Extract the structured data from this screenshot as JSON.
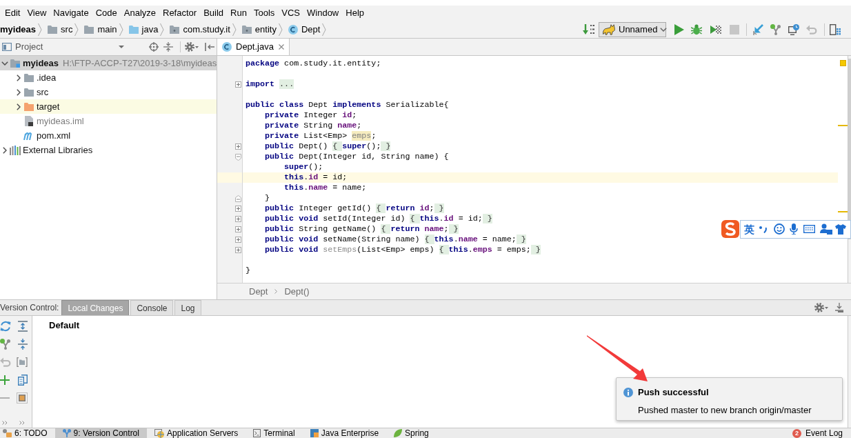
{
  "menu_bar": {
    "items": [
      "Edit",
      "View",
      "Navigate",
      "Code",
      "Analyze",
      "Refactor",
      "Build",
      "Run",
      "Tools",
      "VCS",
      "Window",
      "Help"
    ]
  },
  "navigation_bar": {
    "breadcrumbs": [
      {
        "label": "myideas",
        "kind": "project"
      },
      {
        "label": "src",
        "kind": "folder"
      },
      {
        "label": "main",
        "kind": "folder"
      },
      {
        "label": "java",
        "kind": "source_folder"
      },
      {
        "label": "com.study.it",
        "kind": "package"
      },
      {
        "label": "entity",
        "kind": "package"
      },
      {
        "label": "Dept",
        "kind": "class"
      }
    ],
    "run_configuration": "Unnamed"
  },
  "project_panel": {
    "title": "Project",
    "tree": [
      {
        "label": "myideas",
        "detail": "H:\\FTP-ACCP-T27\\2019-3-18\\myideas",
        "kind": "module",
        "expanded": true,
        "selected": true,
        "highlighted": false,
        "dimmed": false,
        "children": [
          {
            "label": ".idea",
            "kind": "folder",
            "expanded": false,
            "selected": false,
            "highlighted": false,
            "dimmed": false
          },
          {
            "label": "src",
            "kind": "folder",
            "expanded": false,
            "selected": false,
            "highlighted": false,
            "dimmed": false
          },
          {
            "label": "target",
            "kind": "excluded_folder",
            "expanded": false,
            "selected": false,
            "highlighted": true,
            "dimmed": false
          },
          {
            "label": "myideas.iml",
            "kind": "iml_file",
            "selected": false,
            "highlighted": false,
            "dimmed": true
          },
          {
            "label": "pom.xml",
            "kind": "pom_file",
            "selected": false,
            "highlighted": false,
            "dimmed": false
          }
        ]
      },
      {
        "label": "External Libraries",
        "kind": "libraries",
        "expanded": false,
        "selected": false,
        "highlighted": false,
        "dimmed": false
      }
    ]
  },
  "editor": {
    "tabs": [
      {
        "label": "Dept.java",
        "selected": true
      }
    ],
    "lines": [
      {
        "kind": "plain",
        "current": false,
        "tokens": [
          {
            "text": "package",
            "kind": "keyword"
          },
          {
            "text": " com.study.it.entity;",
            "kind": "plain"
          }
        ]
      },
      {
        "kind": "plain",
        "current": false
      },
      {
        "kind": "collapsed_fold",
        "current": false,
        "tokens": [
          {
            "text": "import ",
            "kind": "keyword"
          },
          {
            "text": "...",
            "kind": "folded"
          }
        ]
      },
      {
        "kind": "plain",
        "current": false
      },
      {
        "kind": "plain",
        "current": false,
        "tokens": [
          {
            "text": "public class",
            "kind": "keyword"
          },
          {
            "text": " Dept ",
            "kind": "plain"
          },
          {
            "text": "implements",
            "kind": "keyword"
          },
          {
            "text": " Serializable{",
            "kind": "plain"
          }
        ]
      },
      {
        "kind": "plain",
        "current": false,
        "tokens": [
          {
            "text": "    private",
            "kind": "keyword"
          },
          {
            "text": " Integer ",
            "kind": "plain"
          },
          {
            "text": "id",
            "kind": "field"
          },
          {
            "text": ";",
            "kind": "plain"
          }
        ]
      },
      {
        "kind": "plain",
        "current": false,
        "tokens": [
          {
            "text": "    private",
            "kind": "keyword"
          },
          {
            "text": " String ",
            "kind": "plain"
          },
          {
            "text": "name",
            "kind": "field"
          },
          {
            "text": ";",
            "kind": "plain"
          }
        ]
      },
      {
        "kind": "plain",
        "current": false,
        "tokens": [
          {
            "text": "    private",
            "kind": "keyword"
          },
          {
            "text": " List<Emp> ",
            "kind": "plain"
          },
          {
            "text": "emps",
            "kind": "unused_field"
          },
          {
            "text": ";",
            "kind": "plain"
          }
        ]
      },
      {
        "kind": "collapsed_fold",
        "current": false,
        "tokens": [
          {
            "text": "    public",
            "kind": "keyword"
          },
          {
            "text": " Dept() ",
            "kind": "plain"
          },
          {
            "text": "{ ",
            "kind": "folded"
          },
          {
            "text": "super",
            "kind": "keyword"
          },
          {
            "text": "();",
            "kind": "plain"
          },
          {
            "text": " }",
            "kind": "folded"
          }
        ]
      },
      {
        "kind": "fold_start",
        "current": false,
        "tokens": [
          {
            "text": "    public",
            "kind": "keyword"
          },
          {
            "text": " Dept(Integer id, String name) {",
            "kind": "plain"
          }
        ]
      },
      {
        "kind": "plain",
        "current": false,
        "tokens": [
          {
            "text": "        super",
            "kind": "keyword"
          },
          {
            "text": "();",
            "kind": "plain"
          }
        ]
      },
      {
        "kind": "plain",
        "current": true,
        "tokens": [
          {
            "text": "        this",
            "kind": "keyword"
          },
          {
            "text": ".",
            "kind": "plain"
          },
          {
            "text": "id",
            "kind": "field"
          },
          {
            "text": " = id;",
            "kind": "plain"
          }
        ]
      },
      {
        "kind": "plain",
        "current": false,
        "tokens": [
          {
            "text": "        this",
            "kind": "keyword"
          },
          {
            "text": ".",
            "kind": "plain"
          },
          {
            "text": "name",
            "kind": "field"
          },
          {
            "text": " = name;",
            "kind": "plain"
          }
        ]
      },
      {
        "kind": "fold_end",
        "current": false,
        "tokens": [
          {
            "text": "    }",
            "kind": "plain"
          }
        ]
      },
      {
        "kind": "collapsed_fold",
        "current": false,
        "tokens": [
          {
            "text": "    public",
            "kind": "keyword"
          },
          {
            "text": " Integer getId() ",
            "kind": "plain"
          },
          {
            "text": "{ ",
            "kind": "folded"
          },
          {
            "text": "return ",
            "kind": "keyword"
          },
          {
            "text": "id",
            "kind": "field"
          },
          {
            "text": ";",
            "kind": "plain"
          },
          {
            "text": " }",
            "kind": "folded"
          }
        ]
      },
      {
        "kind": "collapsed_fold",
        "current": false,
        "tokens": [
          {
            "text": "    public void",
            "kind": "keyword"
          },
          {
            "text": " setId(Integer id) ",
            "kind": "plain"
          },
          {
            "text": "{ ",
            "kind": "folded"
          },
          {
            "text": "this",
            "kind": "keyword"
          },
          {
            "text": ".",
            "kind": "plain"
          },
          {
            "text": "id",
            "kind": "field"
          },
          {
            "text": " = id;",
            "kind": "plain"
          },
          {
            "text": " }",
            "kind": "folded"
          }
        ]
      },
      {
        "kind": "collapsed_fold",
        "current": false,
        "tokens": [
          {
            "text": "    public",
            "kind": "keyword"
          },
          {
            "text": " String getName() ",
            "kind": "plain"
          },
          {
            "text": "{ ",
            "kind": "folded"
          },
          {
            "text": "return ",
            "kind": "keyword"
          },
          {
            "text": "name",
            "kind": "field"
          },
          {
            "text": ";",
            "kind": "plain"
          },
          {
            "text": " }",
            "kind": "folded"
          }
        ]
      },
      {
        "kind": "collapsed_fold",
        "current": false,
        "tokens": [
          {
            "text": "    public void",
            "kind": "keyword"
          },
          {
            "text": " setName(String name) ",
            "kind": "plain"
          },
          {
            "text": "{ ",
            "kind": "folded"
          },
          {
            "text": "this",
            "kind": "keyword"
          },
          {
            "text": ".",
            "kind": "plain"
          },
          {
            "text": "name",
            "kind": "field"
          },
          {
            "text": " = name;",
            "kind": "plain"
          },
          {
            "text": " }",
            "kind": "folded"
          }
        ]
      },
      {
        "kind": "collapsed_fold",
        "current": false,
        "tokens": [
          {
            "text": "    public void ",
            "kind": "keyword"
          },
          {
            "text": "setEmps",
            "kind": "unused"
          },
          {
            "text": "(List<Emp> emps) ",
            "kind": "plain"
          },
          {
            "text": "{ ",
            "kind": "folded"
          },
          {
            "text": "this",
            "kind": "keyword"
          },
          {
            "text": ".",
            "kind": "plain"
          },
          {
            "text": "emps",
            "kind": "field"
          },
          {
            "text": " = emps;",
            "kind": "plain"
          },
          {
            "text": " }",
            "kind": "folded"
          }
        ]
      },
      {
        "kind": "plain",
        "current": false
      },
      {
        "kind": "plain",
        "current": false,
        "tokens": [
          {
            "text": "}",
            "kind": "plain"
          }
        ]
      }
    ],
    "breadcrumbs": [
      "Dept",
      "Dept()"
    ]
  },
  "version_control_panel": {
    "title": "Version Control:",
    "tabs": [
      {
        "label": "Local Changes",
        "selected": true
      },
      {
        "label": "Console",
        "selected": false
      },
      {
        "label": "Log",
        "selected": false
      }
    ],
    "changelist": "Default"
  },
  "notification": {
    "title": "Push successful",
    "message": "Pushed master to new branch origin/master"
  },
  "status_bar": {
    "tool_windows": [
      {
        "label": "6: TODO",
        "kind": "todo",
        "selected": false
      },
      {
        "label": "9: Version Control",
        "kind": "version_control",
        "selected": true
      },
      {
        "label": "Application Servers",
        "kind": "servers",
        "selected": false
      },
      {
        "label": "Terminal",
        "kind": "terminal",
        "selected": false
      },
      {
        "label": "Java Enterprise",
        "kind": "java_enterprise",
        "selected": false
      },
      {
        "label": "Spring",
        "kind": "spring",
        "selected": false
      }
    ],
    "event_log": {
      "label": "Event Log",
      "count": "2"
    }
  },
  "input_method_bar": {
    "mode": "英"
  }
}
